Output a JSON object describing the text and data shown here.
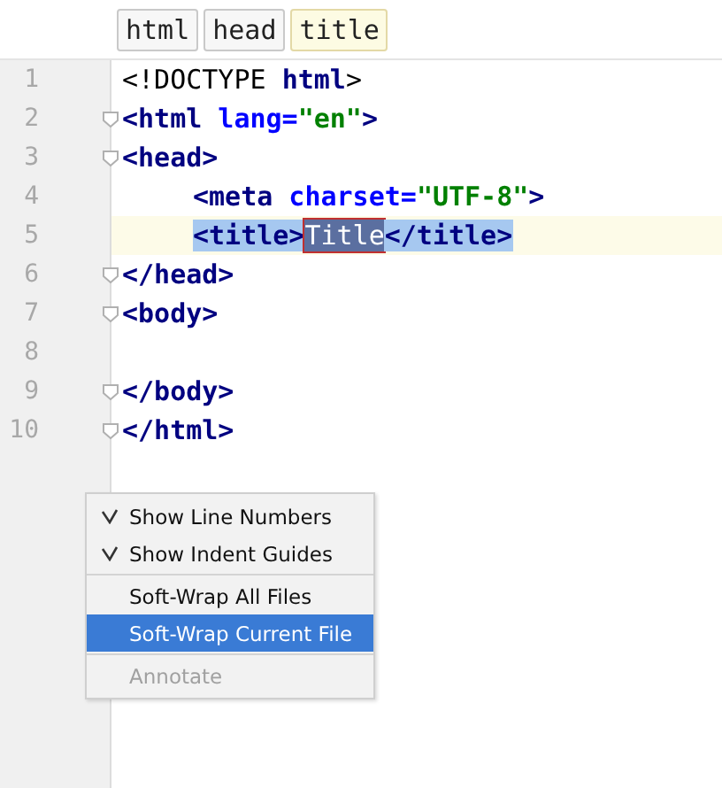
{
  "breadcrumbs": [
    {
      "label": "html",
      "selected": false
    },
    {
      "label": "head",
      "selected": false
    },
    {
      "label": "title",
      "selected": true
    }
  ],
  "editor": {
    "lines": [
      {
        "number": "1",
        "current": false,
        "foldable": false,
        "indent": false,
        "tokens": [
          {
            "text": "<!DOCTYPE ",
            "kind": "plain"
          },
          {
            "text": "html",
            "kind": "keyword"
          },
          {
            "text": ">",
            "kind": "plain"
          }
        ]
      },
      {
        "number": "2",
        "current": false,
        "foldable": true,
        "indent": false,
        "tokens": [
          {
            "text": "<html",
            "kind": "tag"
          },
          {
            "text": " lang=",
            "kind": "attr"
          },
          {
            "text": "\"en\"",
            "kind": "string"
          },
          {
            "text": ">",
            "kind": "tag"
          }
        ]
      },
      {
        "number": "3",
        "current": false,
        "foldable": true,
        "indent": false,
        "tokens": [
          {
            "text": "<head>",
            "kind": "tag"
          }
        ]
      },
      {
        "number": "4",
        "current": false,
        "foldable": false,
        "indent": true,
        "tokens": [
          {
            "text": "<meta",
            "kind": "tag"
          },
          {
            "text": " charset=",
            "kind": "attr"
          },
          {
            "text": "\"UTF-8\"",
            "kind": "string"
          },
          {
            "text": ">",
            "kind": "tag"
          }
        ]
      },
      {
        "number": "5",
        "current": true,
        "foldable": false,
        "indent": true,
        "tokens": [
          {
            "text": "<title>",
            "kind": "selected-tag"
          },
          {
            "text": "Title",
            "kind": "match"
          },
          {
            "text": "</title>",
            "kind": "selected-tag"
          }
        ]
      },
      {
        "number": "6",
        "current": false,
        "foldable": true,
        "indent": false,
        "tokens": [
          {
            "text": "</head>",
            "kind": "tag"
          }
        ]
      },
      {
        "number": "7",
        "current": false,
        "foldable": true,
        "indent": false,
        "tokens": [
          {
            "text": "<body>",
            "kind": "tag"
          }
        ]
      },
      {
        "number": "8",
        "current": false,
        "foldable": false,
        "indent": false
      },
      {
        "number": "9",
        "current": false,
        "foldable": true,
        "indent": false,
        "tokens": [
          {
            "text": "</body>",
            "kind": "tag"
          }
        ]
      },
      {
        "number": "10",
        "current": false,
        "foldable": true,
        "indent": false,
        "tokens": [
          {
            "text": "</html>",
            "kind": "tag"
          }
        ]
      }
    ]
  },
  "context_menu": [
    {
      "kind": "item",
      "label": "Show Line Numbers",
      "checked": true,
      "selected": false,
      "disabled": false
    },
    {
      "kind": "item",
      "label": "Show Indent Guides",
      "checked": true,
      "selected": false,
      "disabled": false
    },
    {
      "kind": "separator"
    },
    {
      "kind": "item",
      "label": "Soft-Wrap All Files",
      "checked": false,
      "selected": false,
      "disabled": false
    },
    {
      "kind": "item",
      "label": "Soft-Wrap Current File",
      "checked": false,
      "selected": true,
      "disabled": false
    },
    {
      "kind": "separator"
    },
    {
      "kind": "item",
      "label": "Annotate",
      "checked": false,
      "selected": false,
      "disabled": true
    }
  ]
}
